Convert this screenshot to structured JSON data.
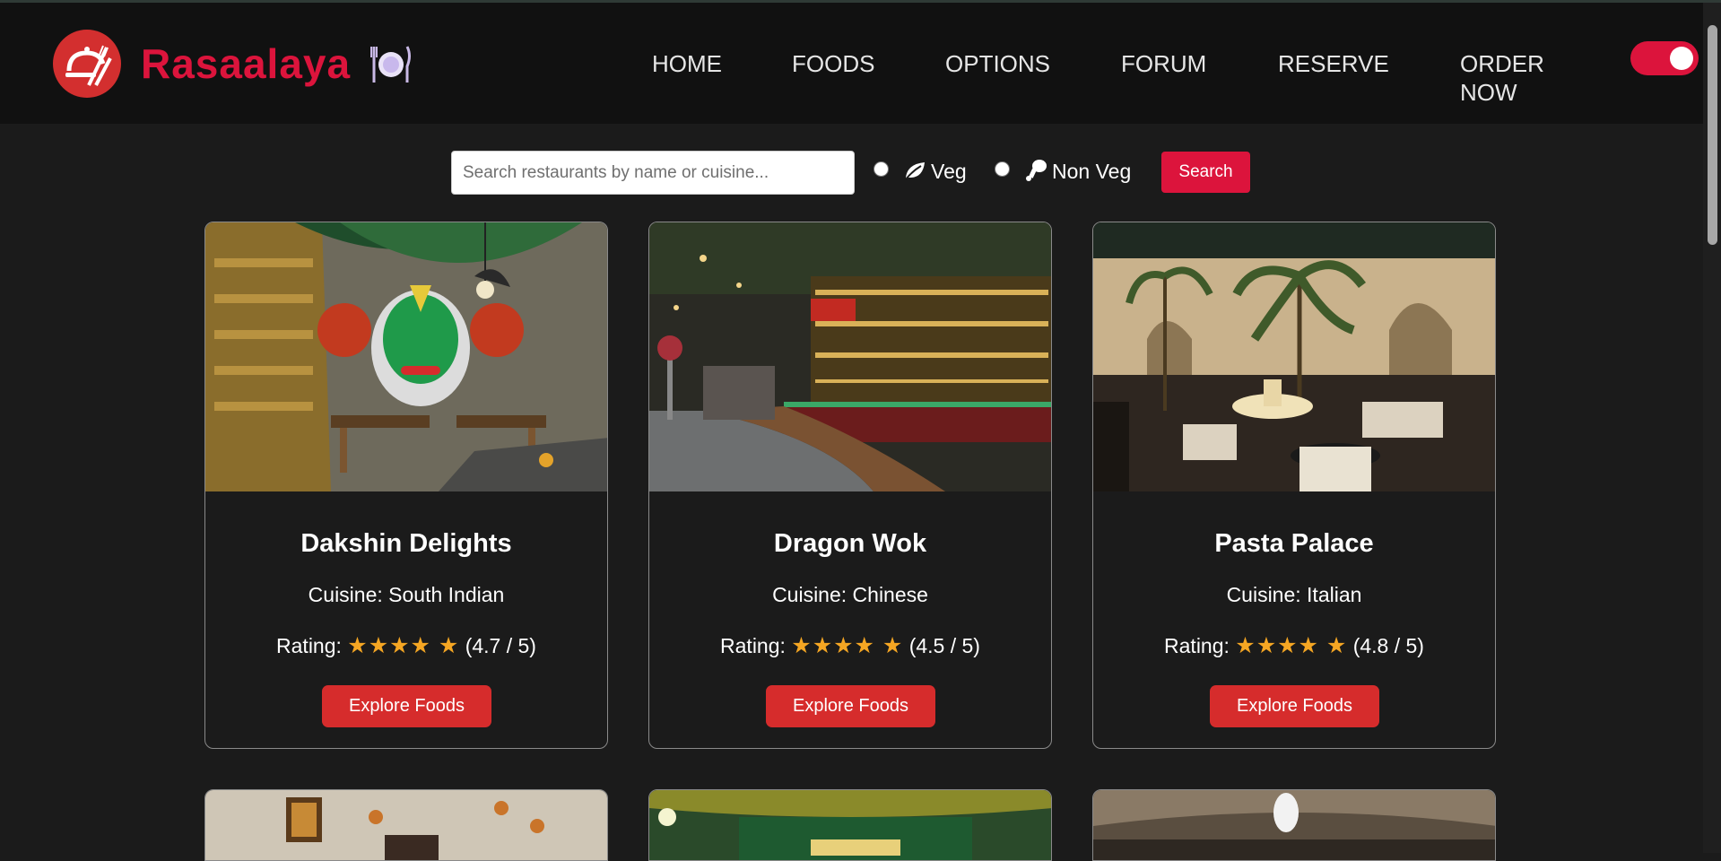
{
  "brand": {
    "name": "Rasaalaya",
    "accent": "#dc143c"
  },
  "nav": {
    "home": "HOME",
    "foods": "FOODS",
    "options": "OPTIONS",
    "forum": "FORUM",
    "reserve": "RESERVE",
    "order_now": "ORDER NOW"
  },
  "theme_toggle": {
    "on": true
  },
  "search": {
    "placeholder": "Search restaurants by name or cuisine...",
    "value": "",
    "veg_label": "Veg",
    "nonveg_label": "Non Veg",
    "button_label": "Search"
  },
  "restaurants": [
    {
      "name": "Dakshin Delights",
      "cuisine": "Cuisine: South Indian",
      "rating_label": "Rating:",
      "stars": "★★★★ ★",
      "rating_text": "(4.7 / 5)",
      "button": "Explore Foods"
    },
    {
      "name": "Dragon Wok",
      "cuisine": "Cuisine: Chinese",
      "rating_label": "Rating:",
      "stars": "★★★★ ★",
      "rating_text": "(4.5 / 5)",
      "button": "Explore Foods"
    },
    {
      "name": "Pasta Palace",
      "cuisine": "Cuisine: Italian",
      "rating_label": "Rating:",
      "stars": "★★★★ ★",
      "rating_text": "(4.8 / 5)",
      "button": "Explore Foods"
    }
  ],
  "colors": {
    "star": "#f5a623",
    "button": "#d62c2c",
    "header_bg": "#111111",
    "page_bg": "#1b1b1b"
  }
}
